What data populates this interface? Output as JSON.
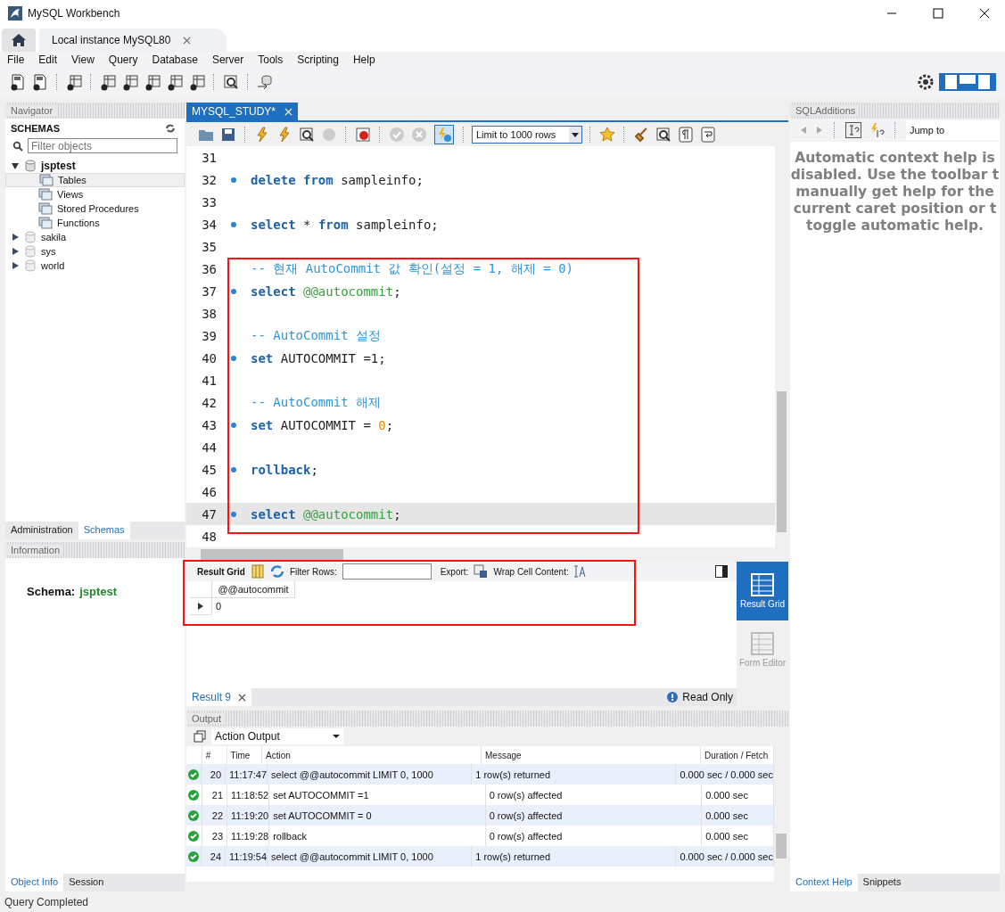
{
  "window": {
    "title": "MySQL Workbench"
  },
  "connection_tabs": [
    {
      "label": "Local instance MySQL80",
      "selected": true
    }
  ],
  "menu": [
    "File",
    "Edit",
    "View",
    "Query",
    "Database",
    "Server",
    "Tools",
    "Scripting",
    "Help"
  ],
  "navigator": {
    "title": "Navigator",
    "heading": "SCHEMAS",
    "filter": {
      "placeholder": "Filter objects"
    },
    "tree": [
      {
        "label": "jsptest",
        "expanded": true,
        "children": [
          {
            "label": "Tables",
            "selected": true
          },
          {
            "label": "Views",
            "selected": false
          },
          {
            "label": "Stored Procedures",
            "selected": false
          },
          {
            "label": "Functions",
            "selected": false
          }
        ]
      },
      {
        "label": "sakila",
        "expanded": false
      },
      {
        "label": "sys",
        "expanded": false
      },
      {
        "label": "world",
        "expanded": false
      }
    ],
    "tabs": [
      {
        "label": "Administration",
        "selected": false
      },
      {
        "label": "Schemas",
        "selected": true
      }
    ]
  },
  "information": {
    "title": "Information",
    "schema_label": "Schema:",
    "schema_value": "jsptest",
    "tabs": [
      {
        "label": "Object Info",
        "selected": true
      },
      {
        "label": "Session",
        "selected": false
      }
    ]
  },
  "editor": {
    "tabs": [
      {
        "label": "MYSQL_STUDY*",
        "selected": true
      }
    ],
    "autocommit_toggle": {
      "on": true
    },
    "limit": "Limit to 1000 rows",
    "lines": [
      {
        "number": "31",
        "marker": false,
        "current": false
      },
      {
        "number": "32",
        "marker": true,
        "current": false,
        "tokens": [
          {
            "kind": "keyword",
            "text": "delete from"
          },
          {
            "kind": "plain",
            "text": " sampleinfo;"
          }
        ]
      },
      {
        "number": "33",
        "marker": false,
        "current": false
      },
      {
        "number": "34",
        "marker": true,
        "current": false,
        "tokens": [
          {
            "kind": "keyword",
            "text": "select"
          },
          {
            "kind": "plain",
            "text": " * "
          },
          {
            "kind": "keyword",
            "text": "from"
          },
          {
            "kind": "plain",
            "text": " sampleinfo;"
          }
        ]
      },
      {
        "number": "35",
        "marker": false,
        "current": false
      },
      {
        "number": "36",
        "marker": false,
        "current": false,
        "tokens": [
          {
            "kind": "comment",
            "text": "-- 현재 AutoCommit 값 확인(설정 = 1, 해제 = 0)"
          }
        ]
      },
      {
        "number": "37",
        "marker": true,
        "current": false,
        "tokens": [
          {
            "kind": "keyword",
            "text": "select"
          },
          {
            "kind": "variable",
            "text": " @@autocommit"
          },
          {
            "kind": "plain",
            "text": ";"
          }
        ]
      },
      {
        "number": "38",
        "marker": false,
        "current": false
      },
      {
        "number": "39",
        "marker": false,
        "current": false,
        "tokens": [
          {
            "kind": "comment",
            "text": "-- AutoCommit 설정"
          }
        ]
      },
      {
        "number": "40",
        "marker": true,
        "current": false,
        "tokens": [
          {
            "kind": "keyword",
            "text": "set"
          },
          {
            "kind": "plain",
            "text": " AUTOCOMMIT =1;"
          }
        ]
      },
      {
        "number": "41",
        "marker": false,
        "current": false
      },
      {
        "number": "42",
        "marker": false,
        "current": false,
        "tokens": [
          {
            "kind": "comment",
            "text": "-- AutoCommit 해제"
          }
        ]
      },
      {
        "number": "43",
        "marker": true,
        "current": false,
        "tokens": [
          {
            "kind": "keyword",
            "text": "set"
          },
          {
            "kind": "plain",
            "text": " AUTOCOMMIT = "
          },
          {
            "kind": "number",
            "text": "0"
          },
          {
            "kind": "plain",
            "text": ";"
          }
        ]
      },
      {
        "number": "44",
        "marker": false,
        "current": false
      },
      {
        "number": "45",
        "marker": true,
        "current": false,
        "tokens": [
          {
            "kind": "keyword",
            "text": "rollback"
          },
          {
            "kind": "plain",
            "text": ";"
          }
        ]
      },
      {
        "number": "46",
        "marker": false,
        "current": false
      },
      {
        "number": "47",
        "marker": true,
        "current": true,
        "tokens": [
          {
            "kind": "keyword",
            "text": "select"
          },
          {
            "kind": "variable",
            "text": " @@autocommit"
          },
          {
            "kind": "plain",
            "text": ";"
          }
        ]
      },
      {
        "number": "48",
        "marker": false,
        "current": false
      }
    ]
  },
  "result": {
    "toolbar": {
      "grid_label": "Result Grid",
      "filter_label": "Filter Rows:",
      "export_label": "Export:",
      "wrap_label": "Wrap Cell Content:"
    },
    "columns": [
      "@@autocommit"
    ],
    "rows": [
      [
        "0"
      ]
    ],
    "side_buttons": [
      {
        "label": "Result Grid",
        "selected": true
      },
      {
        "label": "Form Editor",
        "selected": false
      }
    ],
    "tabs": [
      {
        "label": "Result 9",
        "selected": true
      }
    ],
    "read_only": "Read Only"
  },
  "output": {
    "title": "Output",
    "mode": "Action Output",
    "columns": [
      "#",
      "Time",
      "Action",
      "Message",
      "Duration / Fetch"
    ],
    "rows": [
      {
        "number": "20",
        "time": "11:17:47",
        "action": "select @@autocommit LIMIT 0, 1000",
        "message": "1 row(s) returned",
        "duration": "0.000 sec / 0.000 sec"
      },
      {
        "number": "21",
        "time": "11:18:52",
        "action": "set AUTOCOMMIT =1",
        "message": "0 row(s) affected",
        "duration": "0.000 sec"
      },
      {
        "number": "22",
        "time": "11:19:20",
        "action": "set AUTOCOMMIT = 0",
        "message": "0 row(s) affected",
        "duration": "0.000 sec"
      },
      {
        "number": "23",
        "time": "11:19:28",
        "action": "rollback",
        "message": "0 row(s) affected",
        "duration": "0.000 sec"
      },
      {
        "number": "24",
        "time": "11:19:54",
        "action": "select @@autocommit LIMIT 0, 1000",
        "message": "1 row(s) returned",
        "duration": "0.000 sec / 0.000 sec"
      }
    ]
  },
  "sql_additions": {
    "title": "SQLAdditions",
    "jump": "Jump to",
    "help_lines": [
      "Automatic context help is",
      "disabled. Use the toolbar t",
      "manually get help for the",
      "current caret position or t",
      "toggle automatic help."
    ],
    "tabs": [
      {
        "label": "Context Help",
        "selected": true
      },
      {
        "label": "Snippets",
        "selected": false
      }
    ]
  },
  "status_bar": "Query Completed"
}
